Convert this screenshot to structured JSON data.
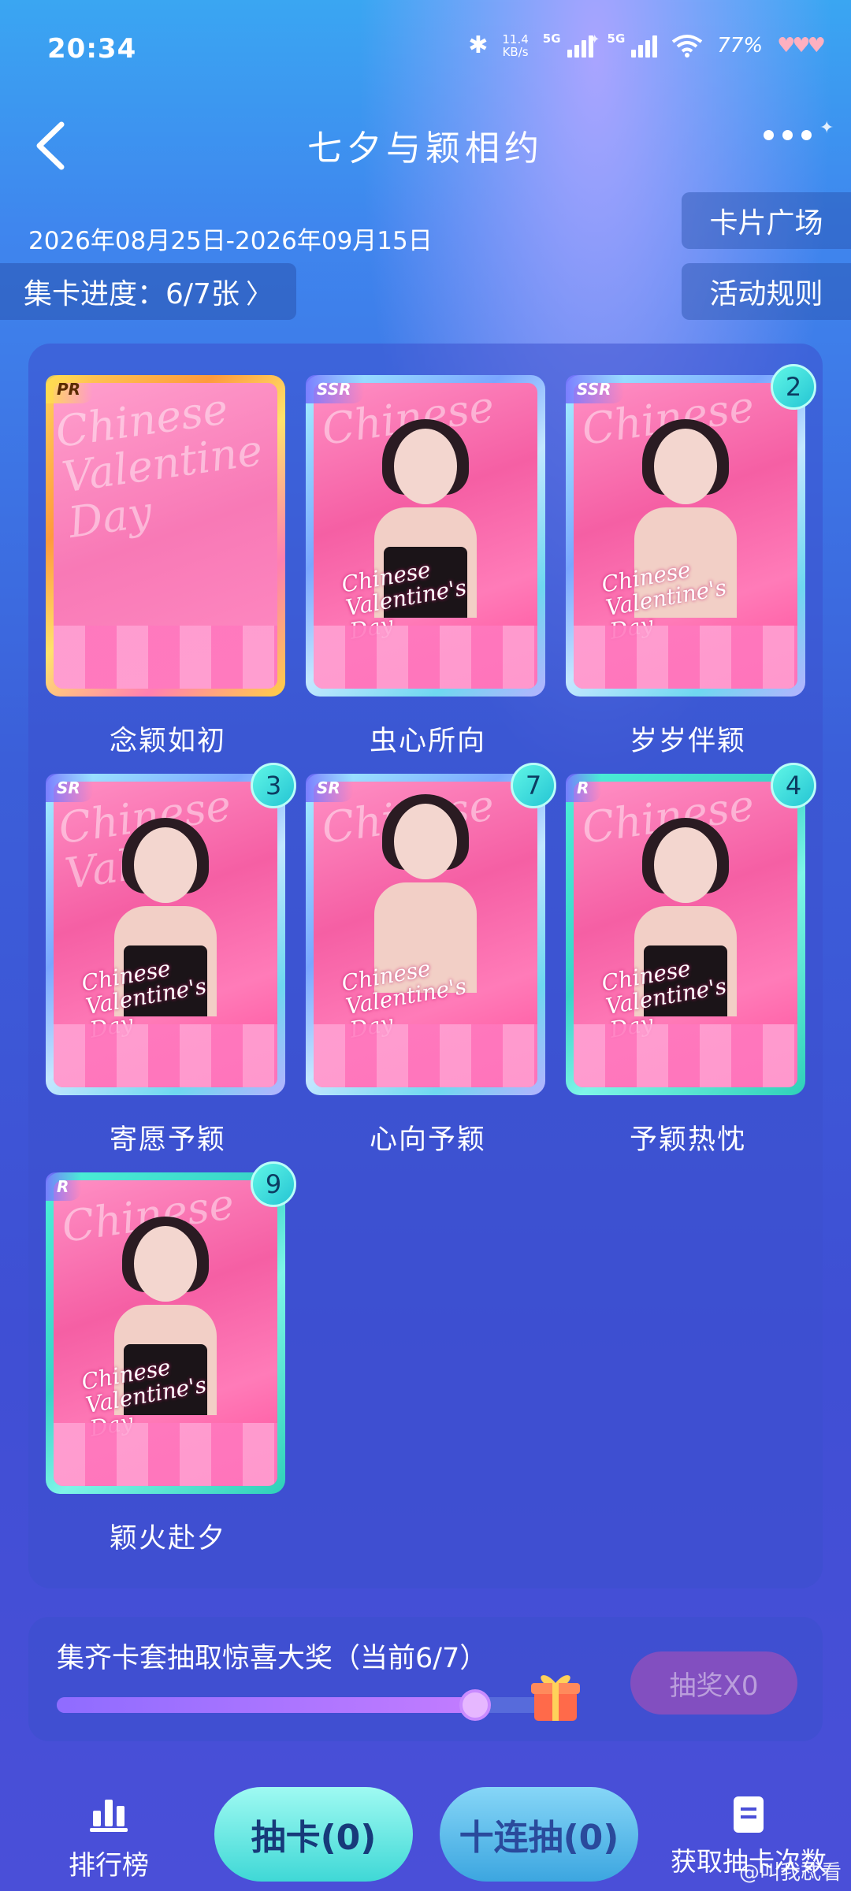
{
  "status_bar": {
    "time": "20:34",
    "speed_value": "11.4",
    "speed_unit": "KB/s",
    "network1": "5G",
    "network2": "5G",
    "battery": "77%"
  },
  "header": {
    "title": "七夕与颖相约",
    "back_icon": "chevron-left-icon",
    "more_icon": "more-dots-icon"
  },
  "event": {
    "date_range": "2026年08月25日-2026年09月15日",
    "progress_label": "集卡进度：6/7张",
    "card_square": "卡片广场",
    "rules": "活动规则"
  },
  "cards": [
    {
      "name": "念颖如初",
      "rarity": "PR",
      "count": ""
    },
    {
      "name": "虫心所向",
      "rarity": "SSR",
      "count": ""
    },
    {
      "name": "岁岁伴颖",
      "rarity": "SSR",
      "count": "2"
    },
    {
      "name": "寄愿予颖",
      "rarity": "SR",
      "count": "3"
    },
    {
      "name": "心向予颖",
      "rarity": "SR",
      "count": "7"
    },
    {
      "name": "予颖热忱",
      "rarity": "R",
      "count": "4"
    },
    {
      "name": "颖火赴夕",
      "rarity": "R",
      "count": "9"
    }
  ],
  "reward": {
    "text": "集齐卡套抽取惊喜大奖（当前6/7）",
    "progress": 0.857,
    "lottery_button": "抽奖X0"
  },
  "bottom_bar": {
    "rank": "排行榜",
    "draw": "抽卡(0)",
    "ten_draw": "十连抽(0)",
    "get_chances": "获取抽卡次数"
  },
  "watermark": "@叫我忒看",
  "colors": {
    "bg_top": "#3aa6f2",
    "bg_bottom": "#4a4fd8",
    "draw_button": "#3fd8d6",
    "ten_button": "#3ca6e0"
  }
}
